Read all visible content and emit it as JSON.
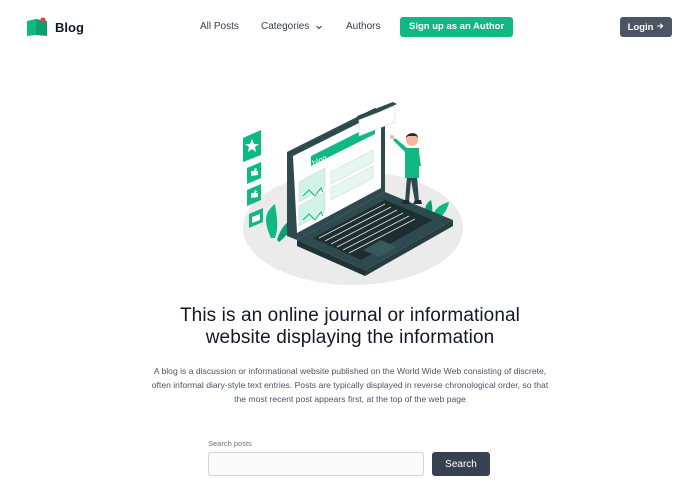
{
  "brand": {
    "name": "Blog",
    "logo_icon": "book-logo-icon",
    "accent": "#10b981"
  },
  "nav": {
    "all_posts": "All Posts",
    "categories": "Categories",
    "categories_icon": "chevron-down-icon",
    "authors": "Authors"
  },
  "header": {
    "signup_label": "Sign up as an Author",
    "login_label": "Login",
    "login_icon": "arrow-right-icon"
  },
  "hero": {
    "illustration": "laptop-blog-illustration",
    "screen_label": "blog",
    "headline_line1": "This is an online journal or informational",
    "headline_line2": "website displaying the information",
    "description_line1": "A blog is a discussion or informational website published on the World Wide Web consisting of discrete,",
    "description_line2": "often informal diary-style text entries. Posts are typically displayed in reverse chronological order, so that",
    "description_line3": "the most recent post appears first, at the top of the web page"
  },
  "search": {
    "label": "Search posts",
    "value": "",
    "placeholder": "",
    "button_label": "Search"
  },
  "colors": {
    "accent_green": "#10b981",
    "login_bg": "#4b5563",
    "search_btn_bg": "#374151",
    "laptop_dark": "#2f4a4f"
  }
}
